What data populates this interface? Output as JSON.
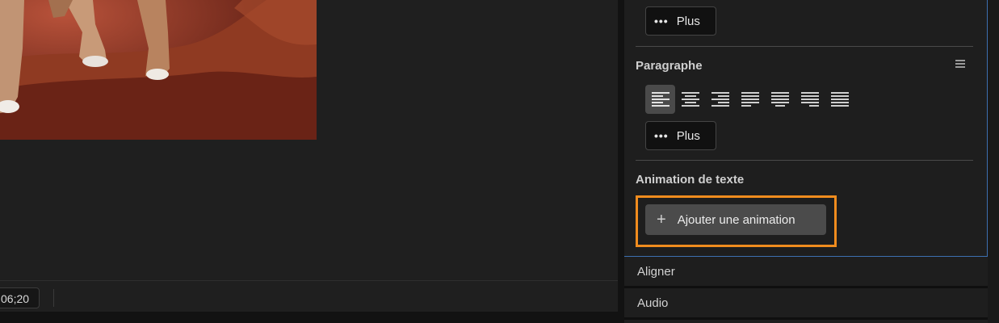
{
  "monitor": {
    "timecode": "06;20"
  },
  "panel": {
    "text_section": {
      "more_label": "Plus"
    },
    "paragraph": {
      "title": "Paragraphe",
      "menu_icon": "hamburger-icon",
      "alignment_buttons": [
        {
          "name": "align-left",
          "active": true
        },
        {
          "name": "align-center",
          "active": false
        },
        {
          "name": "align-right",
          "active": false
        },
        {
          "name": "justify-left",
          "active": false
        },
        {
          "name": "justify-center",
          "active": false
        },
        {
          "name": "justify-right",
          "active": false
        },
        {
          "name": "justify-all",
          "active": false
        }
      ],
      "more_label": "Plus"
    },
    "text_animation": {
      "title": "Animation de texte",
      "add_button_label": "Ajouter une animation",
      "highlight_color": "#f08c1e"
    }
  },
  "collapsed_sections": {
    "align": "Aligner",
    "audio": "Audio"
  },
  "colors": {
    "panel_focus_border": "#3d6fb0",
    "active_button_bg": "#4a4a4a"
  }
}
